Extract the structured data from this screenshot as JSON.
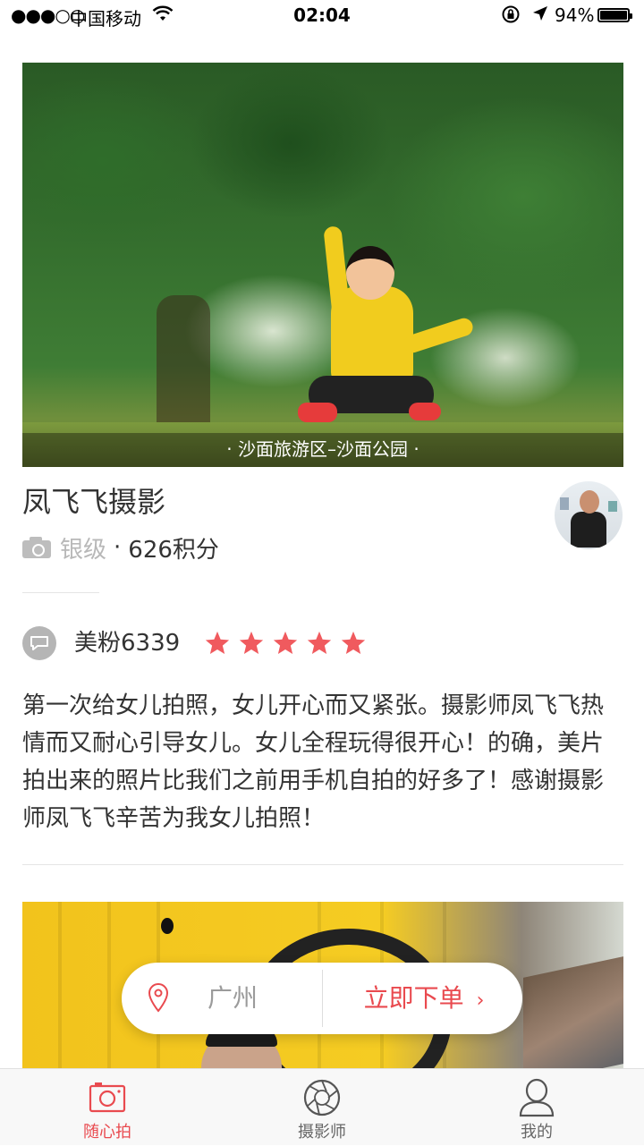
{
  "status_bar": {
    "signal": "●●●○○",
    "carrier": "中国移动",
    "time": "02:04",
    "battery": "94%",
    "icons": [
      "wifi-icon",
      "rotation-lock-icon",
      "location-arrow-icon",
      "battery-icon"
    ]
  },
  "hero": {
    "caption": "· 沙面旅游区–沙面公园 ·"
  },
  "photographer": {
    "name": "凤飞飞摄影",
    "level": "银级",
    "separator": "·",
    "points": "626积分"
  },
  "review": {
    "user": "美粉6339",
    "rating": 5,
    "text": "第一次给女儿拍照，女儿开心而又紧张。摄影师凤飞飞热情而又耐心引导女儿。女儿全程玩得很开心！的确，美片拍出来的照片比我们之前用手机自拍的好多了！感谢摄影师凤飞飞辛苦为我女儿拍照！"
  },
  "order_bar": {
    "city": "广州",
    "order_label": "立即下单",
    "chevron": "›"
  },
  "tabbar": {
    "tabs": [
      {
        "label": "随心拍",
        "icon": "camera-icon",
        "active": true
      },
      {
        "label": "摄影师",
        "icon": "aperture-icon",
        "active": false
      },
      {
        "label": "我的",
        "icon": "user-icon",
        "active": false
      }
    ]
  },
  "colors": {
    "accent": "#e94a4f",
    "star": "#f05a5e",
    "muted": "#b8b8b8"
  }
}
